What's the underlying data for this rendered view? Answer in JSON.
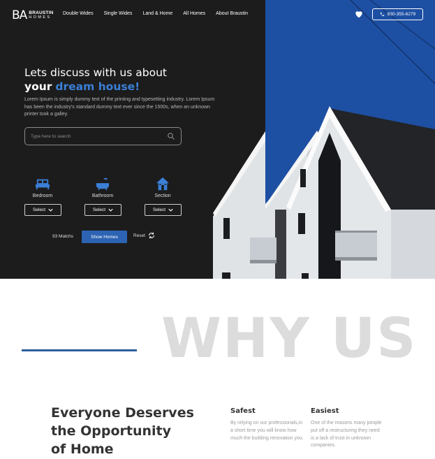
{
  "brand": {
    "mark": "BA",
    "line1": "BRAUSTIN",
    "line2": "HOMES"
  },
  "nav": {
    "items": [
      "Double Wides",
      "Single Wides",
      "Land & Home",
      "All Homes",
      "About Braustin"
    ],
    "phone": "830-355-6279"
  },
  "hero": {
    "heading_line1": "Lets discuss with us about",
    "heading_bold": "your",
    "heading_accent": "dream house!",
    "lead": "Lorem Ipsum is simply dummy text of the printing and typesetting industry. Lorem Ipsum has been the industry's standard dummy text ever since the 1500s, when an unknown printer took a galley.",
    "search_placeholder": "Type here to search"
  },
  "filters": [
    {
      "label": "Bedroom",
      "icon": "bed-icon",
      "select": "Select"
    },
    {
      "label": "Bathroom",
      "icon": "bathtub-icon",
      "select": "Select"
    },
    {
      "label": "Section",
      "icon": "house-icon",
      "select": "Select"
    }
  ],
  "results": {
    "matchs": "93 Matchs",
    "show_button": "Show Homes",
    "reset": "Reset"
  },
  "why": {
    "title": "WHY US",
    "headline_l1": "Everyone Deserves",
    "headline_l2": "the Opportunity",
    "headline_l3": "of Home",
    "col1_title": "Safest",
    "col1_body": "By relying on our professionals,in a short time you will know how much the building renovation you.",
    "col2_title": "Easiest",
    "col2_body": "One of the reasons many people put off a restructuring they need is a lack of trust in unknown companies."
  },
  "colors": {
    "dark": "#1c1c1d",
    "blue": "#1d4fa3",
    "accent": "#3a7fd6",
    "button": "#2c63b3"
  }
}
